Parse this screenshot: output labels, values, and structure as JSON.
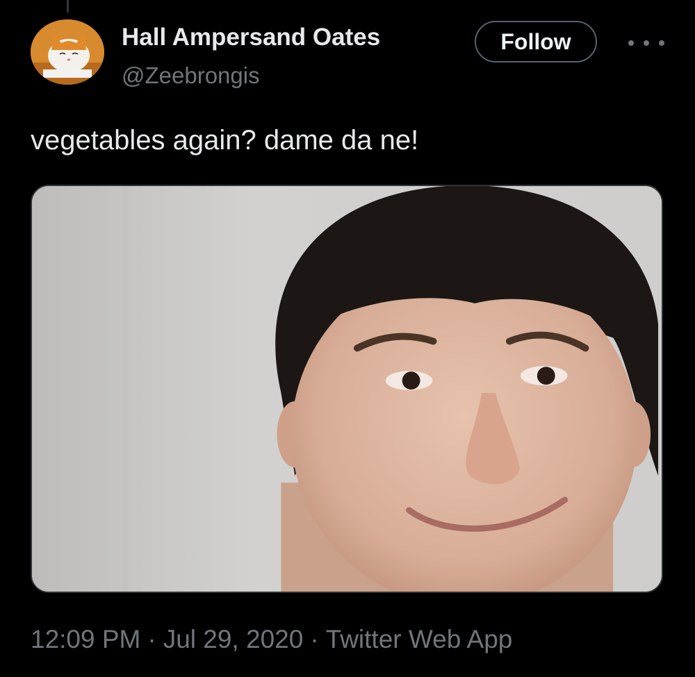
{
  "author": {
    "display_name": "Hall Ampersand Oates",
    "handle": "@Zeebrongis",
    "avatar_icon": "cat-avatar"
  },
  "actions": {
    "follow_label": "Follow",
    "more_icon": "more-horizontal-icon"
  },
  "tweet": {
    "text": "vegetables again? dame da ne!",
    "media_subject": "photo"
  },
  "meta": {
    "time": "12:09 PM",
    "separator": "·",
    "date": "Jul 29, 2020",
    "source": "Twitter Web App"
  },
  "colors": {
    "background": "#000000",
    "primary_text": "#e7e9ea",
    "secondary_text": "#71767b",
    "follow_border": "#536471"
  }
}
